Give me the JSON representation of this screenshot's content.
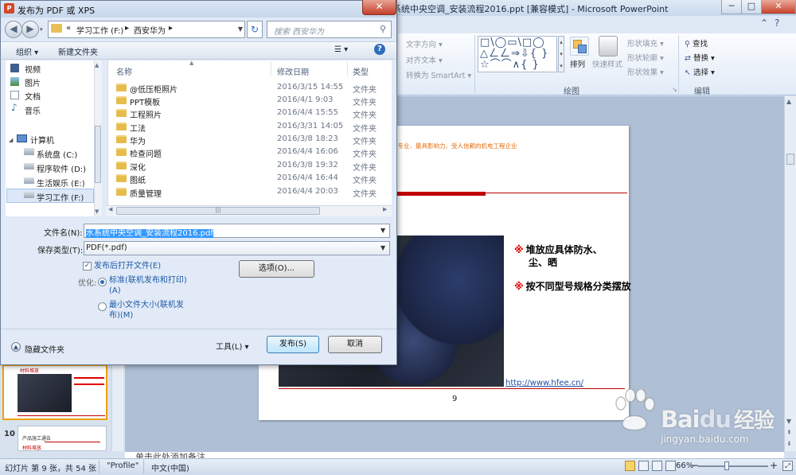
{
  "ppt": {
    "title": "系统中央空调_安装流程2016.ppt [兼容模式] - Microsoft PowerPoint",
    "window_min": "─",
    "window_max": "□",
    "window_close": "✕",
    "ribbon": {
      "text_direction": "文字方向 ▾",
      "align_text": "对齐文本 ▾",
      "convert_smartart": "转换为 SmartArt ▾",
      "shape_gallery": "□\\◯▭\\□◯\n△ㄥㄥ⇒⇩{ }\n☆⌒⌒∧{ }",
      "arrange": "排列",
      "quick_styles": "快速样式",
      "shape_fill": "形状填充 ▾",
      "shape_outline": "形状轮廓 ▾",
      "shape_effects": "形状效果 ▾",
      "find": "查找",
      "replace": "替换 ▾",
      "select": "选择 ▾",
      "group_drawing": "绘图",
      "group_editing": "编辑"
    },
    "slide": {
      "slogan": "最专业、最具影响力、受人信赖的机电工程企业",
      "bullet1_mark": "※",
      "bullet1_line1": "堆放应具体防水、",
      "bullet1_line2": "尘、晒",
      "bullet2_mark": "※",
      "bullet2": "按不同型号规格分类摆放",
      "link": "http://www.hfee.cn/",
      "page_number": "9"
    },
    "notes_placeholder": "单击此处添加备注",
    "thumbnails": {
      "thumb9_caption": "材料堆放",
      "slide10_number": "10",
      "slide10_title": "产品施工通告",
      "slide10_sub": "材料堆放"
    },
    "status": {
      "slide_info": "幻灯片 第 9 张，共 54 张",
      "theme": "\"Profile\"",
      "language": "中文(中国)",
      "zoom": "66%",
      "zoom_minus": "−",
      "zoom_plus": "+"
    },
    "watermark": {
      "brand": "Bai",
      "brand2": "du",
      "brand_cn": "经验",
      "url": "jingyan.baidu.com"
    }
  },
  "dialog": {
    "app_icon": "P",
    "title": "发布为 PDF 或 XPS",
    "close": "✕",
    "back": "◀",
    "forward": "▶",
    "address": {
      "prefix": "«",
      "part1": "学习工作 (F:)",
      "sep1": "▸",
      "part2": "西安华为",
      "sep2": "▸",
      "drop": "▼"
    },
    "refresh": "↻",
    "search_placeholder": "搜索 西安华为",
    "toolbar": {
      "organize": "组织 ▾",
      "new_folder": "新建文件夹",
      "view": "☰ ▾",
      "help": "?"
    },
    "nav_items": [
      "视频",
      "图片",
      "文档",
      "音乐",
      "计算机",
      "系统盘 (C:)",
      "程序软件 (D:)",
      "生活娱乐 (E:)",
      "学习工作 (F:)"
    ],
    "columns": {
      "name": "名称",
      "date": "修改日期",
      "type": "类型"
    },
    "files": [
      {
        "name": "@低压柜照片",
        "date": "2016/3/15 14:55",
        "type": "文件夹"
      },
      {
        "name": "PPT模板",
        "date": "2016/4/1 9:03",
        "type": "文件夹"
      },
      {
        "name": "工程照片",
        "date": "2016/4/4 15:55",
        "type": "文件夹"
      },
      {
        "name": "工法",
        "date": "2016/3/31 14:05",
        "type": "文件夹"
      },
      {
        "name": "华为",
        "date": "2016/3/8 18:23",
        "type": "文件夹"
      },
      {
        "name": "检查问题",
        "date": "2016/4/4 16:06",
        "type": "文件夹"
      },
      {
        "name": "深化",
        "date": "2016/3/8 19:32",
        "type": "文件夹"
      },
      {
        "name": "图纸",
        "date": "2016/4/4 16:44",
        "type": "文件夹"
      },
      {
        "name": "质量管理",
        "date": "2016/4/4 20:03",
        "type": "文件夹"
      }
    ],
    "hscroll_grip": "|||",
    "filename_label": "文件名(N):",
    "filename_value": "水系统中央空调_安装流程2016.pdf",
    "filetype_label": "保存类型(T):",
    "filetype_value": "PDF(*.pdf)",
    "open_after": "发布后打开文件(E)",
    "open_after_check": "✓",
    "optimize_label": "优化:",
    "opt_standard_l1": "标准(联机发布和打印)",
    "opt_standard_l2": "(A)",
    "opt_min_l1": "最小文件大小(联机发",
    "opt_min_l2": "布)(M)",
    "options_button": "选项(O)...",
    "tools": "工具(L)    ▾",
    "publish": "发布(S)",
    "cancel": "取消",
    "hide_folders": "隐藏文件夹",
    "hide_icon": "▲"
  }
}
